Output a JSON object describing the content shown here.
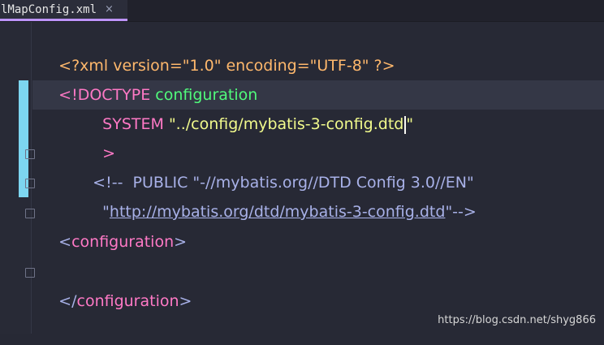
{
  "tab": {
    "title": "lMapConfig.xml",
    "close_glyph": "×"
  },
  "editor": {
    "lines": [
      {
        "parts": [
          "<?xml version=\"1.0\" encoding=\"UTF-8\" ?>"
        ]
      },
      {
        "parts": [
          "<!DOCTYPE",
          " configuration"
        ]
      },
      {
        "parts": [
          "SYSTEM",
          " \"../config/mybatis-3-config.dtd",
          "\""
        ]
      },
      {
        "parts": [
          ">"
        ]
      },
      {
        "parts": [
          "<!--  PUBLIC \"-//mybatis.org//DTD Config 3.0//EN\""
        ]
      },
      {
        "parts": [
          "\"",
          "http://mybatis.org/dtd/mybatis-3-config.dtd",
          "\"-->"
        ]
      },
      {
        "parts": [
          "<",
          "configuration",
          ">"
        ]
      },
      {
        "parts": [
          ""
        ]
      },
      {
        "parts": [
          "</",
          "configuration",
          ">"
        ]
      }
    ]
  },
  "watermark": "https://blog.csdn.net/shyg866",
  "colors": {
    "background": "#272935",
    "processing_instruction": "#ffb86c",
    "keyword": "#ff79c6",
    "name": "#50fa7b",
    "string": "#f1fa8c",
    "comment": "#a8b1e8",
    "change_marker": "#7dd6f0",
    "tab_accent": "#bd93f9"
  }
}
